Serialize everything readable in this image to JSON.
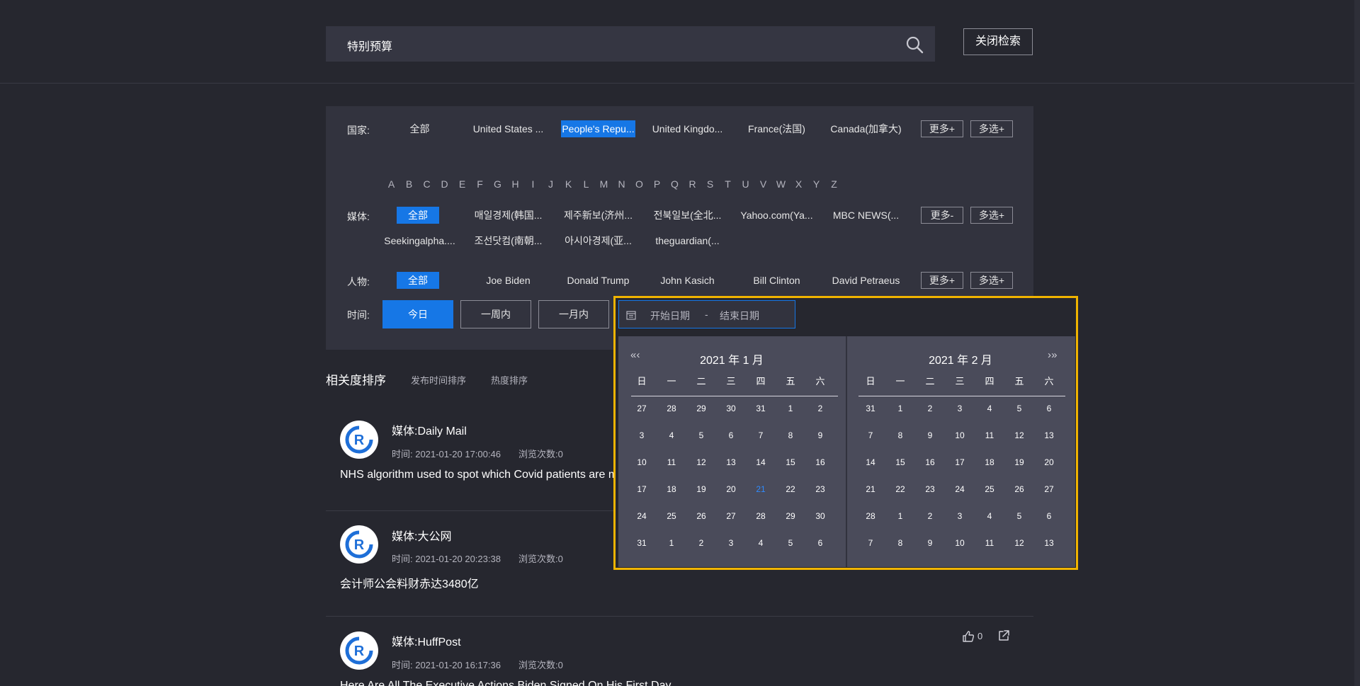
{
  "header": {
    "search_value": "特别预算",
    "close_search_label": "关闭检索"
  },
  "filters": {
    "country": {
      "label": "国家:",
      "items": [
        "全部",
        "United States ...",
        "People's Repu...",
        "United Kingdo...",
        "France(法国)",
        "Canada(加拿大)"
      ],
      "selected": "People's Repu...",
      "more_label": "更多+",
      "multi_label": "多选+"
    },
    "letters": [
      "A",
      "B",
      "C",
      "D",
      "E",
      "F",
      "G",
      "H",
      "I",
      "J",
      "K",
      "L",
      "M",
      "N",
      "O",
      "P",
      "Q",
      "R",
      "S",
      "T",
      "U",
      "V",
      "W",
      "X",
      "Y",
      "Z"
    ],
    "media": {
      "label": "媒体:",
      "items": [
        "全部",
        "매일경제(韩国...",
        "제주新보(济州...",
        "전북일보(全北...",
        "Yahoo.com(Ya...",
        "MBC NEWS(...",
        "Seekingalpha....",
        "조선닷컴(南朝...",
        "아시아경제(亚...",
        "theguardian(..."
      ],
      "selected": "全部",
      "more_label": "更多-",
      "multi_label": "多选+"
    },
    "person": {
      "label": "人物:",
      "items": [
        "全部",
        "Joe Biden",
        "Donald Trump",
        "John Kasich",
        "Bill Clinton",
        "David Petraeus"
      ],
      "selected": "全部",
      "more_label": "更多+",
      "multi_label": "多选+"
    },
    "time": {
      "label": "时间:",
      "buttons": [
        "今日",
        "一周内",
        "一月内"
      ],
      "selected": "今日"
    }
  },
  "sort": {
    "options": [
      "相关度排序",
      "发布时间排序",
      "热度排序"
    ],
    "active": "相关度排序"
  },
  "news": [
    {
      "media": "媒体:Daily Mail",
      "time": "时间: 2021-01-20 17:00:46",
      "views": "浏览次数:0",
      "title": "NHS algorithm used to spot which Covid patients are m"
    },
    {
      "media": "媒体:大公网",
      "time": "时间: 2021-01-20 20:23:38",
      "views": "浏览次数:0",
      "title": "会计师公会料财赤达3480亿"
    },
    {
      "media": "媒体:HuffPost",
      "time": "时间: 2021-01-20 16:17:36",
      "views": "浏览次数:0",
      "title": "Here Are All The Executive Actions Biden Signed On His First Day",
      "likes": "0"
    }
  ],
  "datepicker": {
    "start_placeholder": "开始日期",
    "end_placeholder": "结束日期",
    "separator": "-",
    "weekdays": [
      "日",
      "一",
      "二",
      "三",
      "四",
      "五",
      "六"
    ],
    "left": {
      "title": "2021 年 1 月",
      "nav": "« ‹",
      "weeks": [
        [
          "27",
          "28",
          "29",
          "30",
          "31",
          "1",
          "2"
        ],
        [
          "3",
          "4",
          "5",
          "6",
          "7",
          "8",
          "9"
        ],
        [
          "10",
          "11",
          "12",
          "13",
          "14",
          "15",
          "16"
        ],
        [
          "17",
          "18",
          "19",
          "20",
          "21",
          "22",
          "23"
        ],
        [
          "24",
          "25",
          "26",
          "27",
          "28",
          "29",
          "30"
        ],
        [
          "31",
          "1",
          "2",
          "3",
          "4",
          "5",
          "6"
        ]
      ],
      "today": "21"
    },
    "right": {
      "title": "2021 年 2 月",
      "nav": "› »",
      "weeks": [
        [
          "31",
          "1",
          "2",
          "3",
          "4",
          "5",
          "6"
        ],
        [
          "7",
          "8",
          "9",
          "10",
          "11",
          "12",
          "13"
        ],
        [
          "14",
          "15",
          "16",
          "17",
          "18",
          "19",
          "20"
        ],
        [
          "21",
          "22",
          "23",
          "24",
          "25",
          "26",
          "27"
        ],
        [
          "28",
          "1",
          "2",
          "3",
          "4",
          "5",
          "6"
        ],
        [
          "7",
          "8",
          "9",
          "10",
          "11",
          "12",
          "13"
        ]
      ]
    }
  }
}
